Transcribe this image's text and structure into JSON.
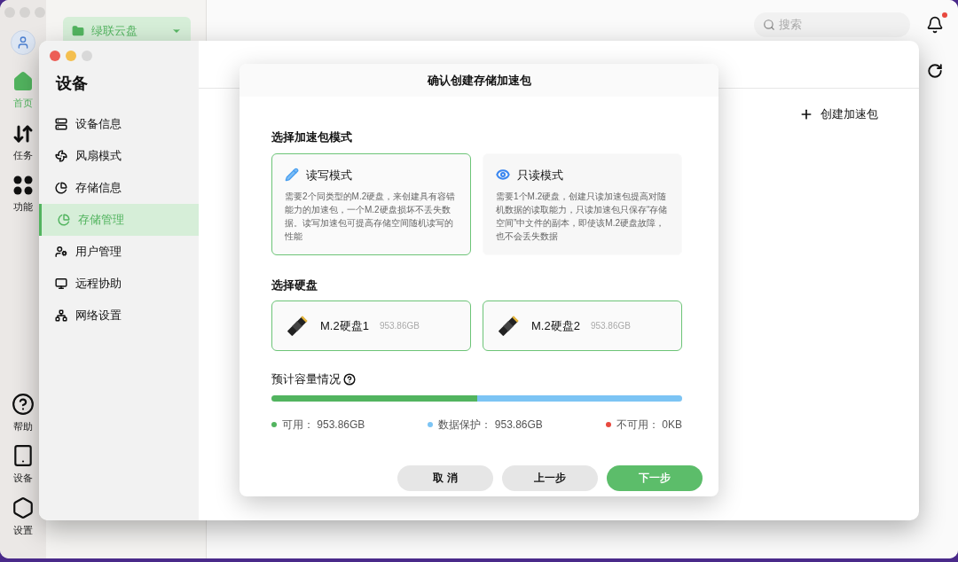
{
  "rail": {
    "items": [
      {
        "label": "首页",
        "kind": "home",
        "selected": true
      },
      {
        "label": "任务",
        "kind": "tasks",
        "selected": false
      },
      {
        "label": "功能",
        "kind": "apps",
        "selected": false
      }
    ],
    "bottom_items": [
      {
        "label": "帮助",
        "kind": "help",
        "selected": false
      },
      {
        "label": "设备",
        "kind": "device",
        "selected": false
      },
      {
        "label": "设置",
        "kind": "settings",
        "selected": false
      }
    ]
  },
  "drive_selector": {
    "label": "绿联云盘"
  },
  "search": {
    "placeholder": "搜索"
  },
  "notifications": {
    "unread": true
  },
  "device_window": {
    "title": "设备",
    "menu": [
      {
        "label": "设备信息",
        "kind": "info",
        "selected": false
      },
      {
        "label": "风扇模式",
        "kind": "fan",
        "selected": false
      },
      {
        "label": "存储信息",
        "kind": "storage",
        "selected": false
      },
      {
        "label": "存储管理",
        "kind": "manage",
        "selected": true
      },
      {
        "label": "用户管理",
        "kind": "users",
        "selected": false
      },
      {
        "label": "远程协助",
        "kind": "remote",
        "selected": false
      },
      {
        "label": "网络设置",
        "kind": "network",
        "selected": false
      }
    ],
    "create_button": "创建加速包"
  },
  "dialog": {
    "title": "确认创建存储加速包",
    "mode_heading": "选择加速包模式",
    "modes": [
      {
        "title": "读写模式",
        "kind": "pencil",
        "selected": true,
        "description": "需要2个同类型的M.2硬盘，来创建具有容错能力的加速包，一个M.2硬盘损坏不丢失数据。读写加速包可提高存储空间随机读写的性能"
      },
      {
        "title": "只读模式",
        "kind": "eye",
        "selected": false,
        "description": "需要1个M.2硬盘，创建只读加速包提高对随机数据的读取能力，只读加速包只保存“存储空间”中文件的副本，即使该M.2硬盘故障，也不会丢失数据"
      }
    ],
    "disk_heading": "选择硬盘",
    "disks": [
      {
        "name": "M.2硬盘1",
        "size": "953.86GB",
        "selected": true
      },
      {
        "name": "M.2硬盘2",
        "size": "953.86GB",
        "selected": true
      }
    ],
    "capacity": {
      "heading": "预计容量情况",
      "segments": [
        {
          "level": 0.5,
          "color": "#52b45f"
        },
        {
          "level": 0.5,
          "color": "#7cc4f4"
        }
      ],
      "legend": [
        {
          "label": "可用： 953.86GB",
          "color": "#52b45f"
        },
        {
          "label": "数据保护： 953.86GB",
          "color": "#7cc4f4"
        },
        {
          "label": "不可用： 0KB",
          "color": "#e8493f"
        }
      ]
    },
    "buttons": [
      {
        "label": "取 消",
        "kind": "secondary"
      },
      {
        "label": "上一步",
        "kind": "secondary"
      },
      {
        "label": "下一步",
        "kind": "primary"
      }
    ]
  }
}
